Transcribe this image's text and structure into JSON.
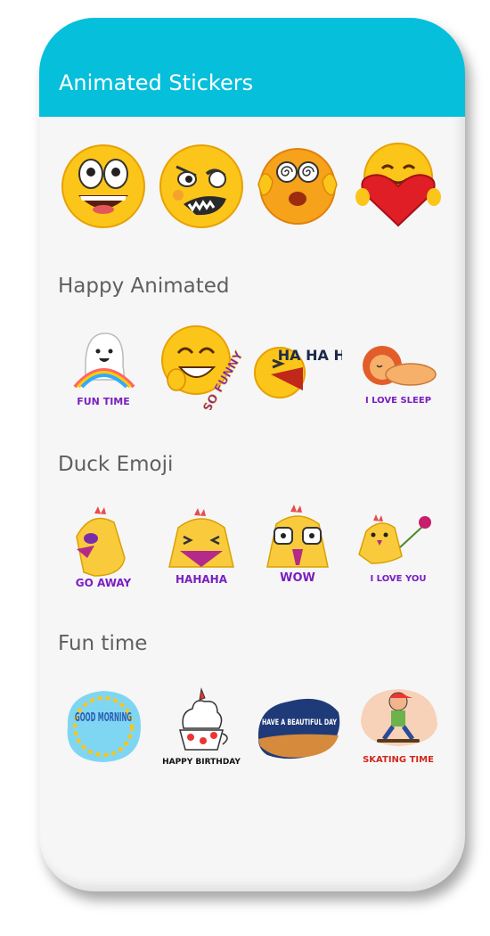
{
  "app": {
    "title": "Animated Stickers"
  },
  "sections": [
    {
      "title": "",
      "stickers": [
        {
          "icon": "wide-eyed-grin-emoji-icon",
          "caption": ""
        },
        {
          "icon": "winking-crazy-emoji-icon",
          "caption": ""
        },
        {
          "icon": "dizzy-eyes-emoji-icon",
          "caption": ""
        },
        {
          "icon": "heart-hug-emoji-icon",
          "caption": ""
        }
      ]
    },
    {
      "title": "Happy Animated",
      "stickers": [
        {
          "icon": "fun-time-ghost-icon",
          "caption": "FUN TIME"
        },
        {
          "icon": "so-funny-laughing-emoji-icon",
          "caption": "SO FUNNY"
        },
        {
          "icon": "hahaha-laughing-face-icon",
          "caption": "HA HA HA"
        },
        {
          "icon": "sleeping-lion-icon",
          "caption": "I LOVE SLEEP"
        }
      ]
    },
    {
      "title": "Duck Emoji",
      "stickers": [
        {
          "icon": "go-away-duck-icon",
          "caption": "GO AWAY"
        },
        {
          "icon": "hahaha-duck-icon",
          "caption": "HAHAHA"
        },
        {
          "icon": "wow-duck-icon",
          "caption": "WOW"
        },
        {
          "icon": "i-love-you-duck-icon",
          "caption": "I LOVE YOU"
        }
      ]
    },
    {
      "title": "Fun time",
      "stickers": [
        {
          "icon": "good-morning-sun-icon",
          "caption": "GOOD MORNING"
        },
        {
          "icon": "birthday-cupcake-icon",
          "caption": "HAPPY BIRTHDAY"
        },
        {
          "icon": "beautiful-day-sunset-icon",
          "caption": "HAVE A BEAUTIFUL DAY"
        },
        {
          "icon": "skateboard-boy-icon",
          "caption": "SKATING TIME"
        }
      ]
    }
  ],
  "colors": {
    "appbar": "#05bfdb",
    "background": "#f6f6f6",
    "emoji_yellow": "#fbc51a",
    "caption_purple": "#6b1fa6"
  }
}
